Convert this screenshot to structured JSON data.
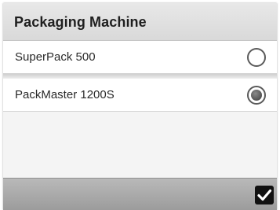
{
  "header": {
    "title": "Packaging Machine"
  },
  "options": [
    {
      "label": "SuperPack 500",
      "selected": false
    },
    {
      "label": "PackMaster 1200S",
      "selected": true
    }
  ],
  "footer": {
    "confirm_icon": "check-icon"
  }
}
